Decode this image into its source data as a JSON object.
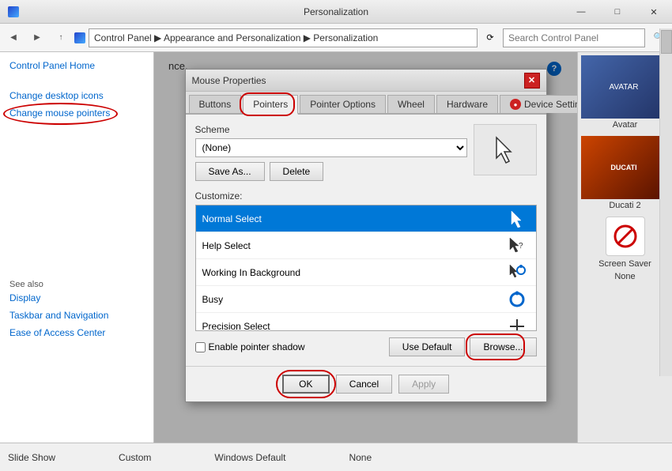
{
  "window": {
    "title": "Personalization",
    "controls": {
      "minimize": "—",
      "maximize": "□",
      "close": "✕"
    }
  },
  "address_bar": {
    "back": "◀",
    "forward": "▶",
    "up": "↑",
    "path": "Control Panel  ▶  Appearance and Personalization  ▶  Personalization",
    "refresh": "⟳",
    "search_placeholder": "Search Control Panel"
  },
  "sidebar": {
    "links": [
      {
        "id": "control-panel-home",
        "label": "Control Panel Home",
        "circled": false
      },
      {
        "id": "change-desktop-icons",
        "label": "Change desktop icons",
        "circled": false
      },
      {
        "id": "change-mouse-pointers",
        "label": "Change mouse pointers",
        "circled": true
      }
    ],
    "see_also": "See also",
    "see_also_links": [
      {
        "id": "display",
        "label": "Display"
      },
      {
        "id": "taskbar",
        "label": "Taskbar and Navigation"
      },
      {
        "id": "ease",
        "label": "Ease of Access Center"
      }
    ]
  },
  "content": {
    "text": "nce."
  },
  "right_panel": {
    "items": [
      {
        "id": "avatar",
        "label": "Avatar",
        "color": "#6688aa"
      },
      {
        "id": "ducati2",
        "label": "Ducati 2",
        "color": "#884422"
      }
    ],
    "bottom": {
      "label": "Screen Saver",
      "sub_label": "None"
    }
  },
  "status_bar": {
    "items": [
      "Slide Show",
      "Custom",
      "Windows Default",
      "None"
    ]
  },
  "dialog": {
    "title": "Mouse Properties",
    "tabs": [
      {
        "id": "buttons",
        "label": "Buttons",
        "active": false
      },
      {
        "id": "pointers",
        "label": "Pointers",
        "active": true
      },
      {
        "id": "pointer-options",
        "label": "Pointer Options",
        "active": false
      },
      {
        "id": "wheel",
        "label": "Wheel",
        "active": false
      },
      {
        "id": "hardware",
        "label": "Hardware",
        "active": false
      },
      {
        "id": "device-settings",
        "label": "Device Settings",
        "active": false,
        "has_icon": true
      }
    ],
    "scheme": {
      "label": "Scheme",
      "value": "(None)",
      "save_as_label": "Save As...",
      "delete_label": "Delete"
    },
    "customize": {
      "label": "Customize:",
      "items": [
        {
          "id": "normal-select",
          "name": "Normal Select",
          "selected": true,
          "icon": "↖"
        },
        {
          "id": "help-select",
          "name": "Help Select",
          "selected": false,
          "icon": "↖?"
        },
        {
          "id": "working-bg",
          "name": "Working In Background",
          "selected": false,
          "icon": "⟳"
        },
        {
          "id": "busy",
          "name": "Busy",
          "selected": false,
          "icon": "○"
        },
        {
          "id": "precision-select",
          "name": "Precision Select",
          "selected": false,
          "icon": "✛"
        }
      ]
    },
    "shadow_checkbox": "Enable pointer shadow",
    "shadow_checked": false,
    "use_default_label": "Use Default",
    "browse_label": "Browse...",
    "ok_label": "OK",
    "cancel_label": "Cancel",
    "apply_label": "Apply"
  },
  "circles": [
    {
      "id": "circle-pointers-tab",
      "note": "circles the Pointers tab"
    },
    {
      "id": "circle-change-mouse",
      "note": "circles Change mouse pointers link"
    },
    {
      "id": "circle-browse",
      "note": "circles Browse button"
    },
    {
      "id": "circle-ok",
      "note": "circles OK button"
    }
  ]
}
